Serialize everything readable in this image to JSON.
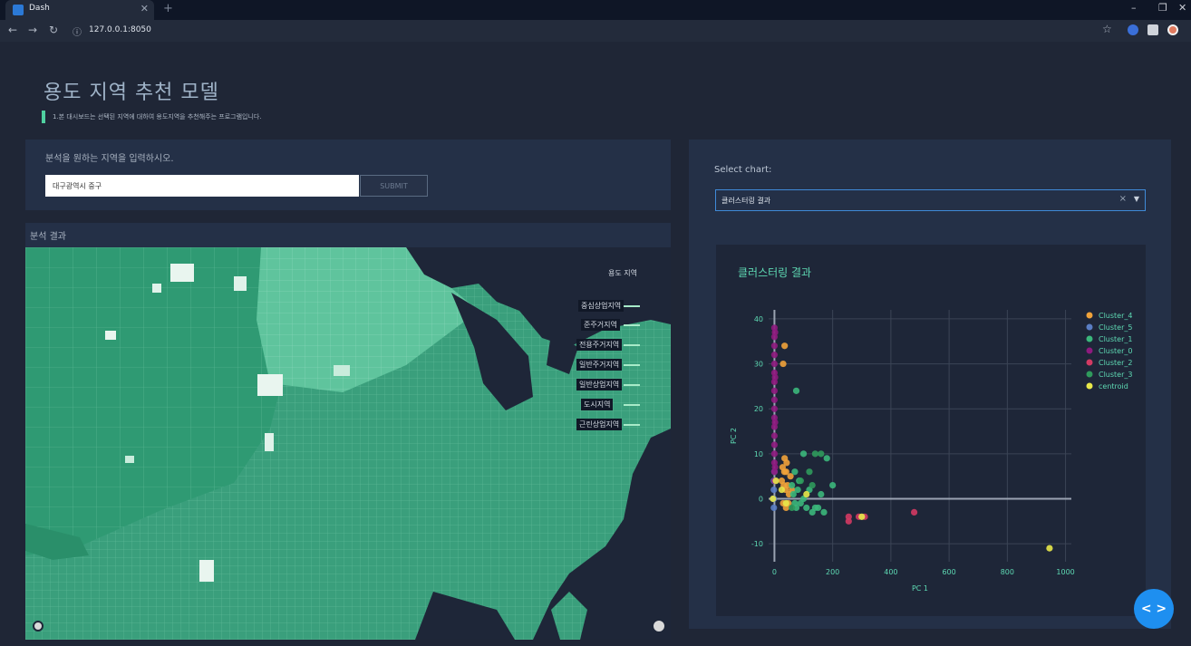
{
  "browser": {
    "tab_title": "Dash",
    "url": "127.0.0.1:8050"
  },
  "header": {
    "title": "용도 지역 추천 모델",
    "subtitle": "1.본 대시보드는 선택된 지역에 대하여 용도지역을 추천해주는 프로그램입니다."
  },
  "input_panel": {
    "label": "분석을 원하는 지역을 입력하시오.",
    "input_value": "대구광역시 중구",
    "submit_label": "SUBMIT"
  },
  "result_panel": {
    "label": "분석 결과",
    "legend_title": "용도 지역",
    "legend_items": [
      "중심상업지역",
      "준주거지역",
      "전용주거지역",
      "일반주거지역",
      "일반상업지역",
      "도시지역",
      "근린상업지역"
    ]
  },
  "chart_selector": {
    "label": "Select chart:",
    "selected": "클러스터링 결과"
  },
  "colors": {
    "accent": "#4fd0a0",
    "cluster_4": "#f0a23a",
    "cluster_5": "#5a7ec4",
    "cluster_1": "#3bb77b",
    "cluster_0": "#8e1a7e",
    "cluster_2": "#d23a63",
    "cluster_3": "#2f9a5c",
    "centroid": "#e8e84a"
  },
  "chart_data": {
    "type": "scatter",
    "title": "클러스터링 결과",
    "xlabel": "PC 1",
    "ylabel": "PC 2",
    "xlim": [
      -20,
      1020
    ],
    "ylim": [
      -14,
      42
    ],
    "xticks": [
      0,
      200,
      400,
      600,
      800,
      1000
    ],
    "yticks": [
      -10,
      0,
      10,
      20,
      30,
      40
    ],
    "grid": true,
    "legend_position": "right",
    "series": [
      {
        "name": "Cluster_4",
        "color": "#f0a23a",
        "points": [
          [
            35,
            34
          ],
          [
            30,
            30
          ],
          [
            35,
            9
          ],
          [
            28,
            7
          ],
          [
            40,
            6
          ],
          [
            25,
            4
          ],
          [
            45,
            3
          ],
          [
            38,
            2
          ],
          [
            50,
            1
          ],
          [
            30,
            -1
          ],
          [
            40,
            -2
          ],
          [
            55,
            5
          ],
          [
            42,
            8
          ],
          [
            34,
            6
          ],
          [
            48,
            -1
          ],
          [
            32,
            3
          ],
          [
            60,
            2
          ]
        ]
      },
      {
        "name": "Cluster_5",
        "color": "#5a7ec4",
        "points": [
          [
            -2,
            2
          ],
          [
            -2,
            0
          ],
          [
            -2,
            -2
          ],
          [
            -2,
            4
          ],
          [
            0,
            6
          ]
        ]
      },
      {
        "name": "Cluster_1",
        "color": "#3bb77b",
        "points": [
          [
            75,
            24
          ],
          [
            70,
            -1
          ],
          [
            80,
            2
          ],
          [
            90,
            -1
          ],
          [
            100,
            0
          ],
          [
            120,
            2
          ],
          [
            140,
            -2
          ],
          [
            160,
            1
          ],
          [
            180,
            9
          ],
          [
            200,
            3
          ],
          [
            100,
            10
          ],
          [
            70,
            6
          ],
          [
            85,
            4
          ],
          [
            110,
            -2
          ],
          [
            130,
            -3
          ],
          [
            150,
            -2
          ],
          [
            170,
            -3
          ],
          [
            60,
            3
          ],
          [
            65,
            1
          ],
          [
            75,
            -2
          ]
        ]
      },
      {
        "name": "Cluster_0",
        "color": "#8e1a7e",
        "points": [
          [
            0,
            38
          ],
          [
            0,
            36
          ],
          [
            0,
            34
          ],
          [
            0,
            32
          ],
          [
            0,
            30
          ],
          [
            0,
            28
          ],
          [
            0,
            26
          ],
          [
            0,
            24
          ],
          [
            0,
            22
          ],
          [
            0,
            20
          ],
          [
            0,
            18
          ],
          [
            0,
            16
          ],
          [
            0,
            14
          ],
          [
            0,
            12
          ],
          [
            0,
            10
          ],
          [
            0,
            8
          ],
          [
            0,
            6
          ],
          [
            0,
            4
          ],
          [
            2,
            37
          ],
          [
            2,
            27
          ],
          [
            2,
            17
          ],
          [
            2,
            7
          ]
        ]
      },
      {
        "name": "Cluster_2",
        "color": "#d23a63",
        "points": [
          [
            255,
            -4
          ],
          [
            255,
            -5
          ],
          [
            290,
            -4
          ],
          [
            310,
            -4
          ],
          [
            480,
            -3
          ]
        ]
      },
      {
        "name": "Cluster_3",
        "color": "#2f9a5c",
        "points": [
          [
            140,
            10
          ],
          [
            160,
            10
          ],
          [
            120,
            6
          ],
          [
            130,
            3
          ],
          [
            90,
            4
          ],
          [
            60,
            -2
          ]
        ]
      },
      {
        "name": "centroid",
        "color": "#e8e84a",
        "points": [
          [
            -5,
            0
          ],
          [
            5,
            4
          ],
          [
            25,
            2
          ],
          [
            40,
            -1
          ],
          [
            110,
            1
          ],
          [
            300,
            -4
          ],
          [
            945,
            -11
          ]
        ]
      }
    ]
  }
}
